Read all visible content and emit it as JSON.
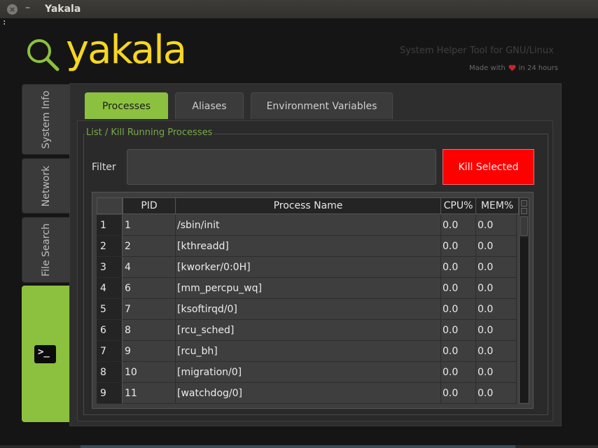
{
  "window": {
    "title": "Yakala",
    "close_glyph": "×",
    "minimize_glyph": "–"
  },
  "terminal_glyph": ":",
  "logo": {
    "text": "yakala",
    "icon": "magnifier-icon",
    "icon_color": "#8cc13f",
    "text_color": "#f6d622"
  },
  "header": {
    "subtitle": "System Helper Tool for GNU/Linux",
    "made_with_prefix": "Made with",
    "made_with_suffix": "in 24 hours",
    "heart_color": "#c0262b"
  },
  "sidebar": {
    "items": [
      {
        "label": "System Info",
        "active": false
      },
      {
        "label": "Network",
        "active": false
      },
      {
        "label": "File Search",
        "active": false
      },
      {
        "label": "Terminal",
        "icon": "terminal-icon",
        "active": true
      }
    ]
  },
  "tabs": [
    {
      "label": "Processes",
      "active": true
    },
    {
      "label": "Aliases",
      "active": false
    },
    {
      "label": "Environment Variables",
      "active": false
    }
  ],
  "processes": {
    "group_title": "List / Kill Running Processes",
    "filter_label": "Filter",
    "filter_value": "",
    "kill_button": "Kill Selected",
    "accent_color": "#8cc13f",
    "kill_color": "#ff0000",
    "columns": [
      "PID",
      "Process Name",
      "CPU%",
      "MEM%"
    ],
    "rows": [
      {
        "num": "1",
        "pid": "1",
        "name": "/sbin/init",
        "cpu": "0.0",
        "mem": "0.0"
      },
      {
        "num": "2",
        "pid": "2",
        "name": "[kthreadd]",
        "cpu": "0.0",
        "mem": "0.0"
      },
      {
        "num": "3",
        "pid": "4",
        "name": "[kworker/0:0H]",
        "cpu": "0.0",
        "mem": "0.0"
      },
      {
        "num": "4",
        "pid": "6",
        "name": "[mm_percpu_wq]",
        "cpu": "0.0",
        "mem": "0.0"
      },
      {
        "num": "5",
        "pid": "7",
        "name": "[ksoftirqd/0]",
        "cpu": "0.0",
        "mem": "0.0"
      },
      {
        "num": "6",
        "pid": "8",
        "name": "[rcu_sched]",
        "cpu": "0.0",
        "mem": "0.0"
      },
      {
        "num": "7",
        "pid": "9",
        "name": "[rcu_bh]",
        "cpu": "0.0",
        "mem": "0.0"
      },
      {
        "num": "8",
        "pid": "10",
        "name": "[migration/0]",
        "cpu": "0.0",
        "mem": "0.0"
      },
      {
        "num": "9",
        "pid": "11",
        "name": "[watchdog/0]",
        "cpu": "0.0",
        "mem": "0.0"
      }
    ]
  }
}
